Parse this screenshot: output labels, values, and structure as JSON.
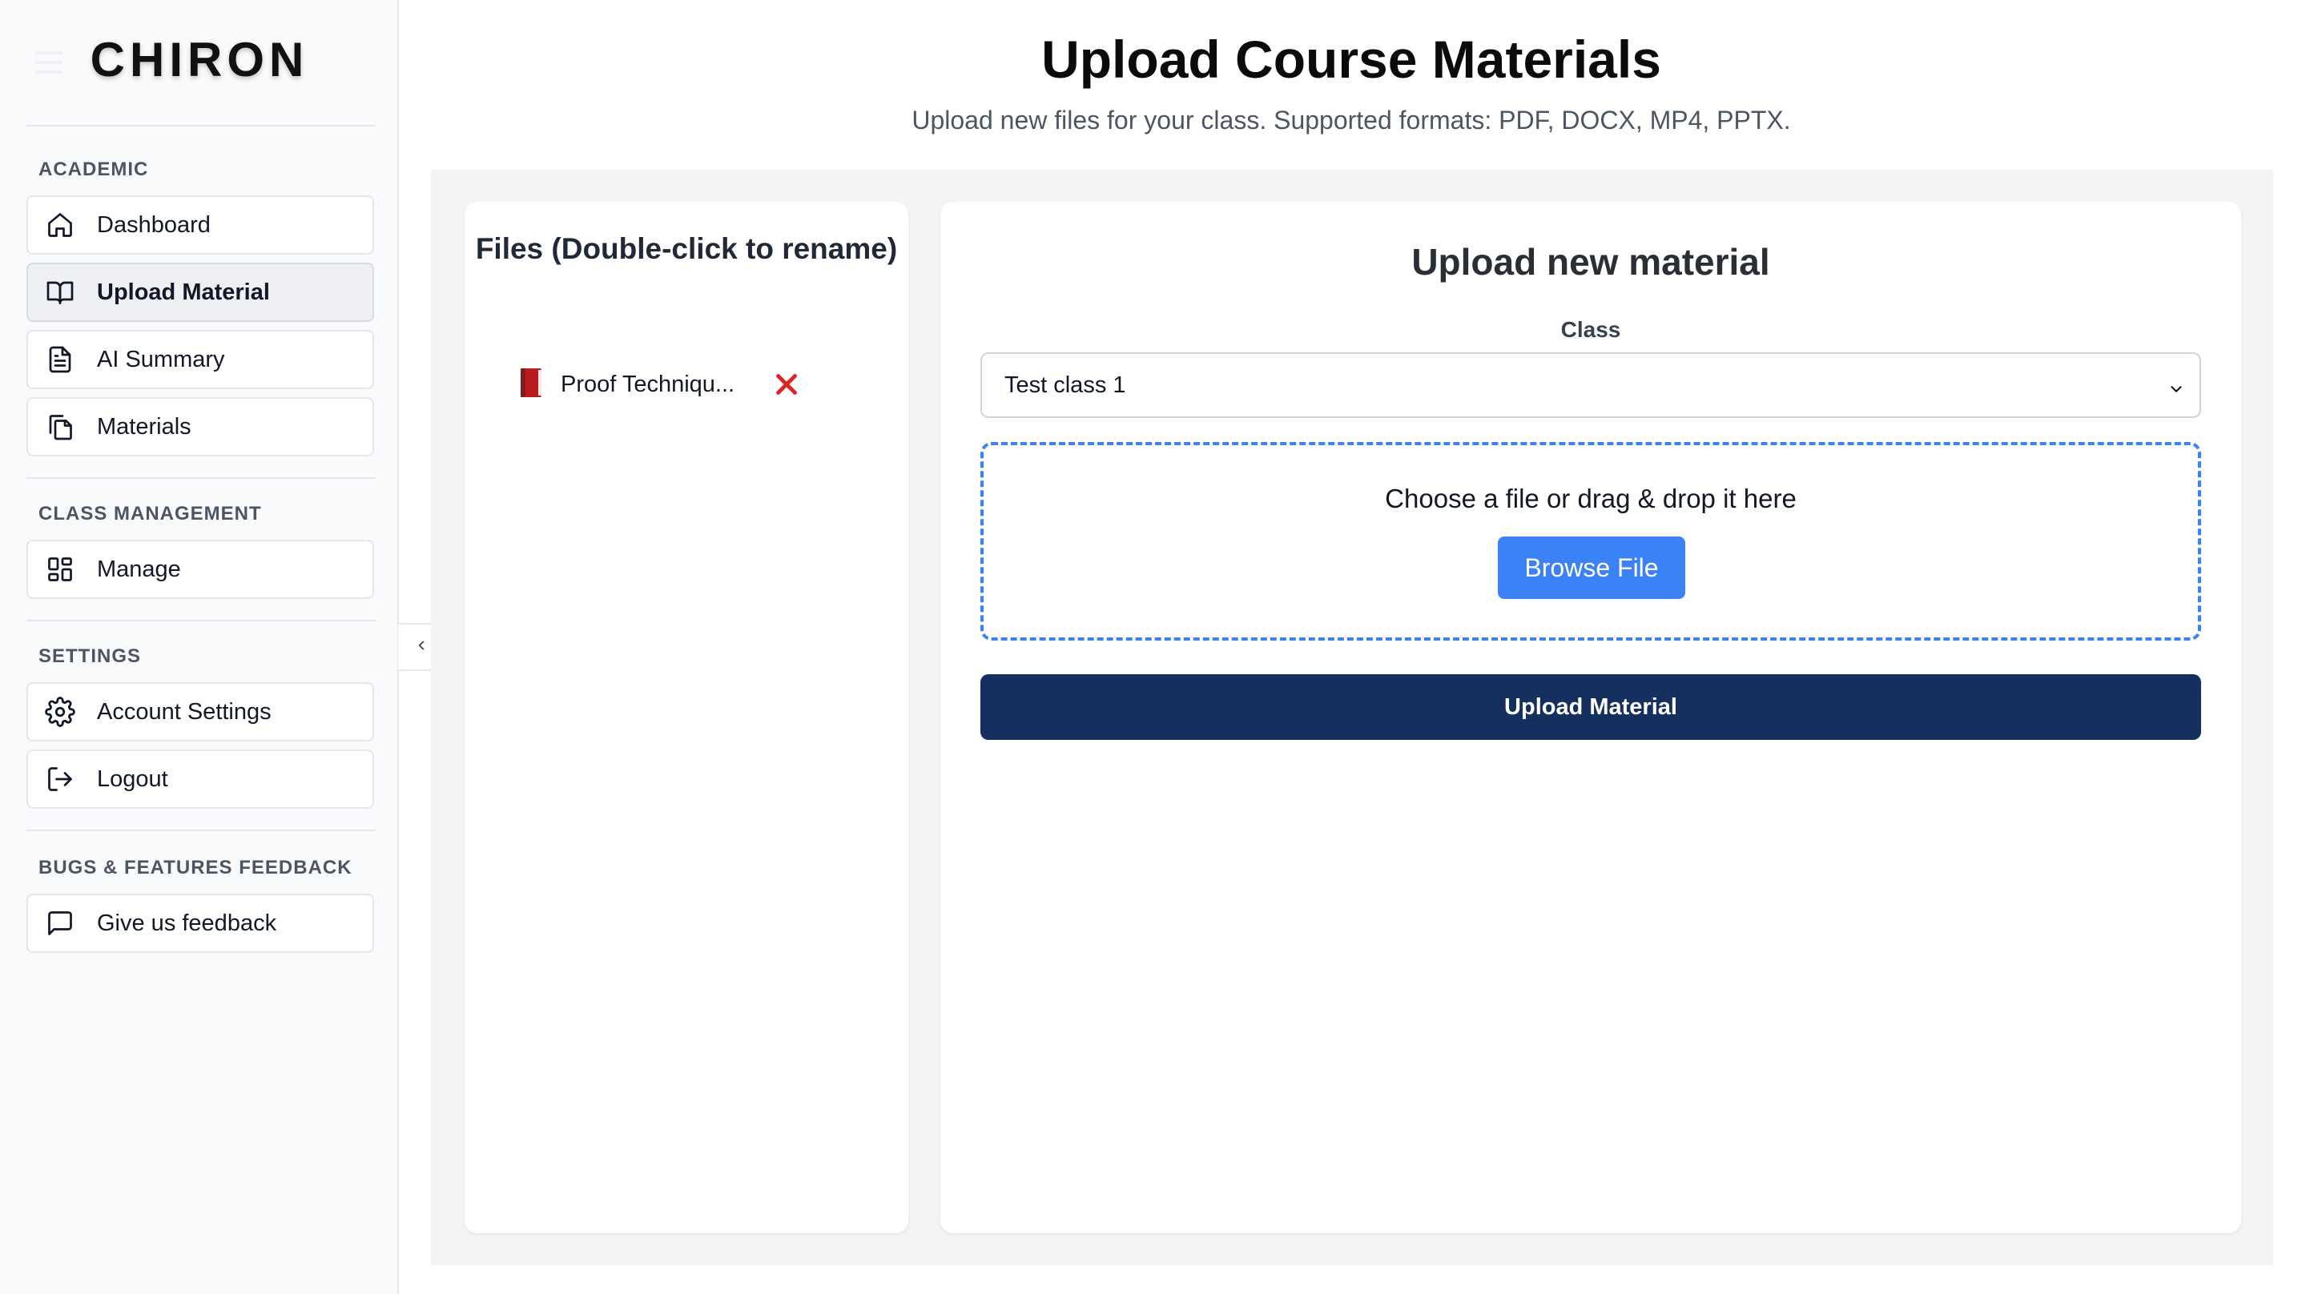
{
  "app": {
    "logo": "CHIRON"
  },
  "sidebar": {
    "sections": [
      {
        "label": "ACADEMIC",
        "items": [
          {
            "label": "Dashboard",
            "icon": "home-icon"
          },
          {
            "label": "Upload Material",
            "icon": "book-open-icon",
            "active": true
          },
          {
            "label": "AI Summary",
            "icon": "file-text-icon"
          },
          {
            "label": "Materials",
            "icon": "copy-icon"
          }
        ]
      },
      {
        "label": "CLASS MANAGEMENT",
        "items": [
          {
            "label": "Manage",
            "icon": "layout-grid-icon"
          }
        ]
      },
      {
        "label": "SETTINGS",
        "items": [
          {
            "label": "Account Settings",
            "icon": "gear-icon"
          },
          {
            "label": "Logout",
            "icon": "logout-icon"
          }
        ]
      },
      {
        "label": "BUGS & FEATURES FEEDBACK",
        "items": [
          {
            "label": "Give us feedback",
            "icon": "message-square-icon"
          }
        ]
      }
    ]
  },
  "header": {
    "title": "Upload Course Materials",
    "subtitle": "Upload new files for your class. Supported formats: PDF, DOCX, MP4, PPTX."
  },
  "files_panel": {
    "title": "Files (Double-click to rename)",
    "files": [
      {
        "name": "Proof Techniqu...",
        "icon": "book-icon"
      }
    ]
  },
  "upload_panel": {
    "title": "Upload new material",
    "class_label": "Class",
    "class_value": "Test class 1",
    "dropzone_text": "Choose a file or drag & drop it here",
    "browse_label": "Browse File",
    "submit_label": "Upload Material"
  },
  "colors": {
    "primary_blue": "#3b82f6",
    "navy": "#15305e",
    "delete_red": "#dc2626",
    "sidebar_bg": "#f9fafb",
    "workspace_bg": "#f3f4f6"
  }
}
